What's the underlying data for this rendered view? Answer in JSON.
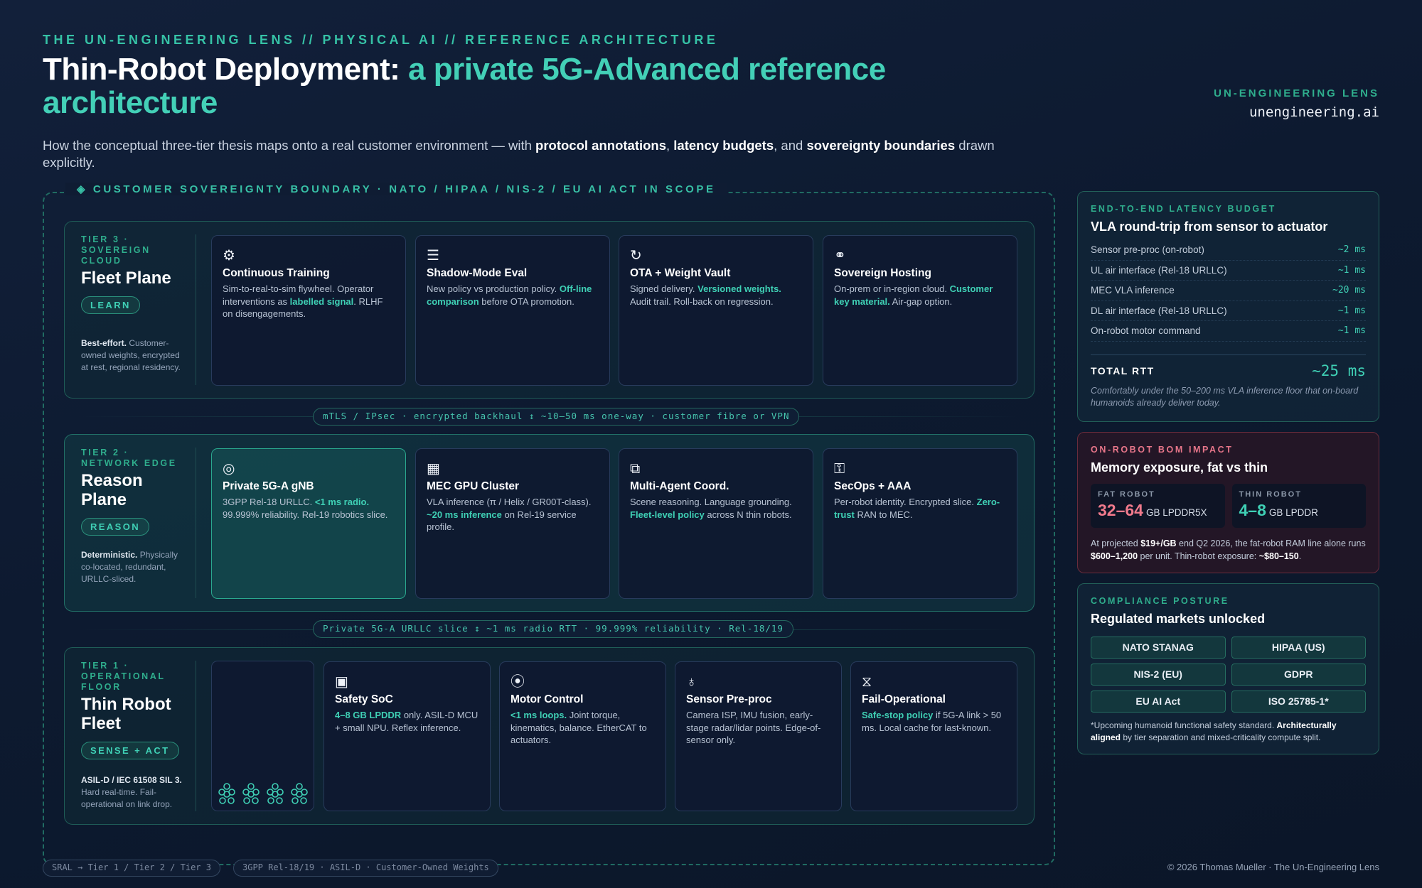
{
  "kicker": "THE UN-ENGINEERING LENS // PHYSICAL AI // REFERENCE ARCHITECTURE",
  "title": {
    "main": "Thin-Robot Deployment:",
    "highlight": "a private 5G-Advanced reference architecture"
  },
  "brand": {
    "kicker": "UN-ENGINEERING LENS",
    "url": "unengineering.ai"
  },
  "intro": {
    "a": "How the conceptual three-tier thesis maps onto a real customer environment — with ",
    "b1": "protocol annotations",
    "c": ", ",
    "b2": "latency budgets",
    "d": ", and ",
    "b3": "sovereignty boundaries",
    "e": " drawn explicitly."
  },
  "boundary_label": "◈ CUSTOMER SOVEREIGNTY BOUNDARY · NATO / HIPAA / NIS-2 / EU AI ACT IN SCOPE",
  "tiers": [
    {
      "kicker": "TIER 3 · SOVEREIGN CLOUD",
      "name": "Fleet Plane",
      "pill": "LEARN",
      "note_b": "Best-effort.",
      "note": " Customer-owned weights, encrypted at rest, regional residency.",
      "cards": [
        {
          "icon": "gear-icon",
          "glyph": "⚙",
          "title": "Continuous Training",
          "d1": "Sim-to-real-to-sim flywheel. Operator interventions as ",
          "h1": "labelled signal",
          "d2": ". RLHF on disengagements.",
          "h2": "",
          "d3": ""
        },
        {
          "icon": "list-icon",
          "glyph": "☰",
          "title": "Shadow-Mode Eval",
          "d1": "New policy vs production policy. ",
          "h1": "Off-line comparison",
          "d2": " before OTA promotion.",
          "h2": "",
          "d3": ""
        },
        {
          "icon": "refresh-icon",
          "glyph": "↻",
          "title": "OTA + Weight Vault",
          "d1": "Signed delivery. ",
          "h1": "Versioned weights.",
          "d2": " Audit trail. Roll-back on regression.",
          "h2": "",
          "d3": ""
        },
        {
          "icon": "link-icon",
          "glyph": "⚭",
          "title": "Sovereign Hosting",
          "d1": "On-prem or in-region cloud. ",
          "h1": "Customer key material.",
          "d2": " Air-gap option.",
          "h2": "",
          "d3": ""
        }
      ]
    },
    {
      "kicker": "TIER 2 · NETWORK EDGE",
      "name": "Reason Plane",
      "pill": "REASON",
      "note_b": "Deterministic.",
      "note": " Physically co-located, redundant, URLLC-sliced.",
      "cards": [
        {
          "icon": "target-icon",
          "glyph": "◎",
          "title": "Private 5G-A gNB",
          "d1": "3GPP Rel-18 URLLC. ",
          "h1": "<1 ms radio.",
          "d2": " 99.999% reliability. Rel-19 robotics slice.",
          "h2": "",
          "d3": ""
        },
        {
          "icon": "grid-icon",
          "glyph": "▦",
          "title": "MEC GPU Cluster",
          "d1": "VLA inference (π / Helix / GR00T-class). ",
          "h1": "~20 ms inference",
          "d2": " on Rel-19 service profile.",
          "h2": "",
          "d3": ""
        },
        {
          "icon": "layers-icon",
          "glyph": "⧉",
          "title": "Multi-Agent Coord.",
          "d1": "Scene reasoning. Language grounding. ",
          "h1": "Fleet-level policy",
          "d2": " across N thin robots.",
          "h2": "",
          "d3": ""
        },
        {
          "icon": "key-icon",
          "glyph": "⚿",
          "title": "SecOps + AAA",
          "d1": "Per-robot identity. Encrypted slice. ",
          "h1": "Zero-trust",
          "d2": " RAN to MEC.",
          "h2": "",
          "d3": ""
        }
      ]
    },
    {
      "kicker": "TIER 1 · OPERATIONAL FLOOR",
      "name": "Thin Robot Fleet",
      "pill": "SENSE + ACT",
      "note_b": "ASIL-D / IEC 61508 SIL 3.",
      "note": " Hard real-time. Fail-operational on link drop.",
      "cards": [
        {
          "icon": "chip-icon",
          "glyph": "▣",
          "title": "Safety SoC",
          "d1": "",
          "h1": "4–8 GB LPDDR",
          "d2": " only. ASIL-D MCU + small NPU. Reflex inference.",
          "h2": "",
          "d3": ""
        },
        {
          "icon": "dial-icon",
          "glyph": "⦿",
          "title": "Motor Control",
          "d1": "",
          "h1": "<1 ms loops.",
          "d2": " Joint torque, kinematics, balance. EtherCAT to actuators.",
          "h2": "",
          "d3": ""
        },
        {
          "icon": "sensor-icon",
          "glyph": "♁",
          "title": "Sensor Pre-proc",
          "d1": "Camera ISP, IMU fusion, early-stage radar/lidar points. Edge-of-sensor only.",
          "h1": "",
          "d2": "",
          "h2": "",
          "d3": ""
        },
        {
          "icon": "hourglass-icon",
          "glyph": "⧖",
          "title": "Fail-Operational",
          "d1": "",
          "h1": "Safe-stop policy",
          "d2": " if 5G-A link > 50 ms. Local cache for last-known.",
          "h2": "",
          "d3": ""
        }
      ]
    }
  ],
  "links": [
    "mTLS / IPsec · encrypted backhaul  ↕  ~10–50 ms one-way · customer fibre or VPN",
    "Private 5G-A URLLC slice  ↕  ~1 ms radio RTT · 99.999% reliability · Rel-18/19"
  ],
  "latency": {
    "kicker": "END-TO-END LATENCY BUDGET",
    "title": "VLA round-trip from sensor to actuator",
    "rows": [
      {
        "label": "Sensor pre-proc (on-robot)",
        "value": "~2 ms"
      },
      {
        "label": "UL air interface (Rel-18 URLLC)",
        "value": "~1 ms"
      },
      {
        "label": "MEC VLA inference",
        "value": "~20 ms"
      },
      {
        "label": "DL air interface (Rel-18 URLLC)",
        "value": "~1 ms"
      },
      {
        "label": "On-robot motor command",
        "value": "~1 ms"
      }
    ],
    "total_label": "TOTAL RTT",
    "total_value": "~25 ms",
    "note": "Comfortably under the 50–200 ms VLA inference floor that on-board humanoids already deliver today."
  },
  "bom": {
    "kicker": "ON-ROBOT BOM IMPACT",
    "title": "Memory exposure, fat vs thin",
    "fat_label": "FAT ROBOT",
    "fat_value": "32–64",
    "fat_unit": "GB LPDDR5X",
    "fat_color": "#f07a8c",
    "thin_label": "THIN ROBOT",
    "thin_value": "4–8",
    "thin_unit": "GB LPDDR",
    "thin_color": "#3fd0b5",
    "t1": "At projected ",
    "b1": "$19+/GB",
    "t2": " end Q2 2026, the fat-robot RAM line alone runs ",
    "b2": "$600–1,200",
    "t3": " per unit. Thin-robot exposure: ",
    "b3": "~$80–150",
    "t4": "."
  },
  "compliance": {
    "kicker": "COMPLIANCE POSTURE",
    "title": "Regulated markets unlocked",
    "tags": [
      "NATO STANAG",
      "HIPAA (US)",
      "NIS-2 (EU)",
      "GDPR",
      "EU AI Act",
      "ISO 25785-1*"
    ],
    "n1": "*Upcoming humanoid functional safety standard. ",
    "nb": "Architecturally aligned",
    "n2": " by tier separation and mixed-criticality compute split."
  },
  "footer": {
    "pill1": "SRAL → Tier 1 / Tier 2 / Tier 3",
    "pill2": "3GPP Rel-18/19 · ASIL-D · Customer-Owned Weights",
    "copyright": "© 2026 Thomas Mueller · The Un-Engineering Lens"
  }
}
